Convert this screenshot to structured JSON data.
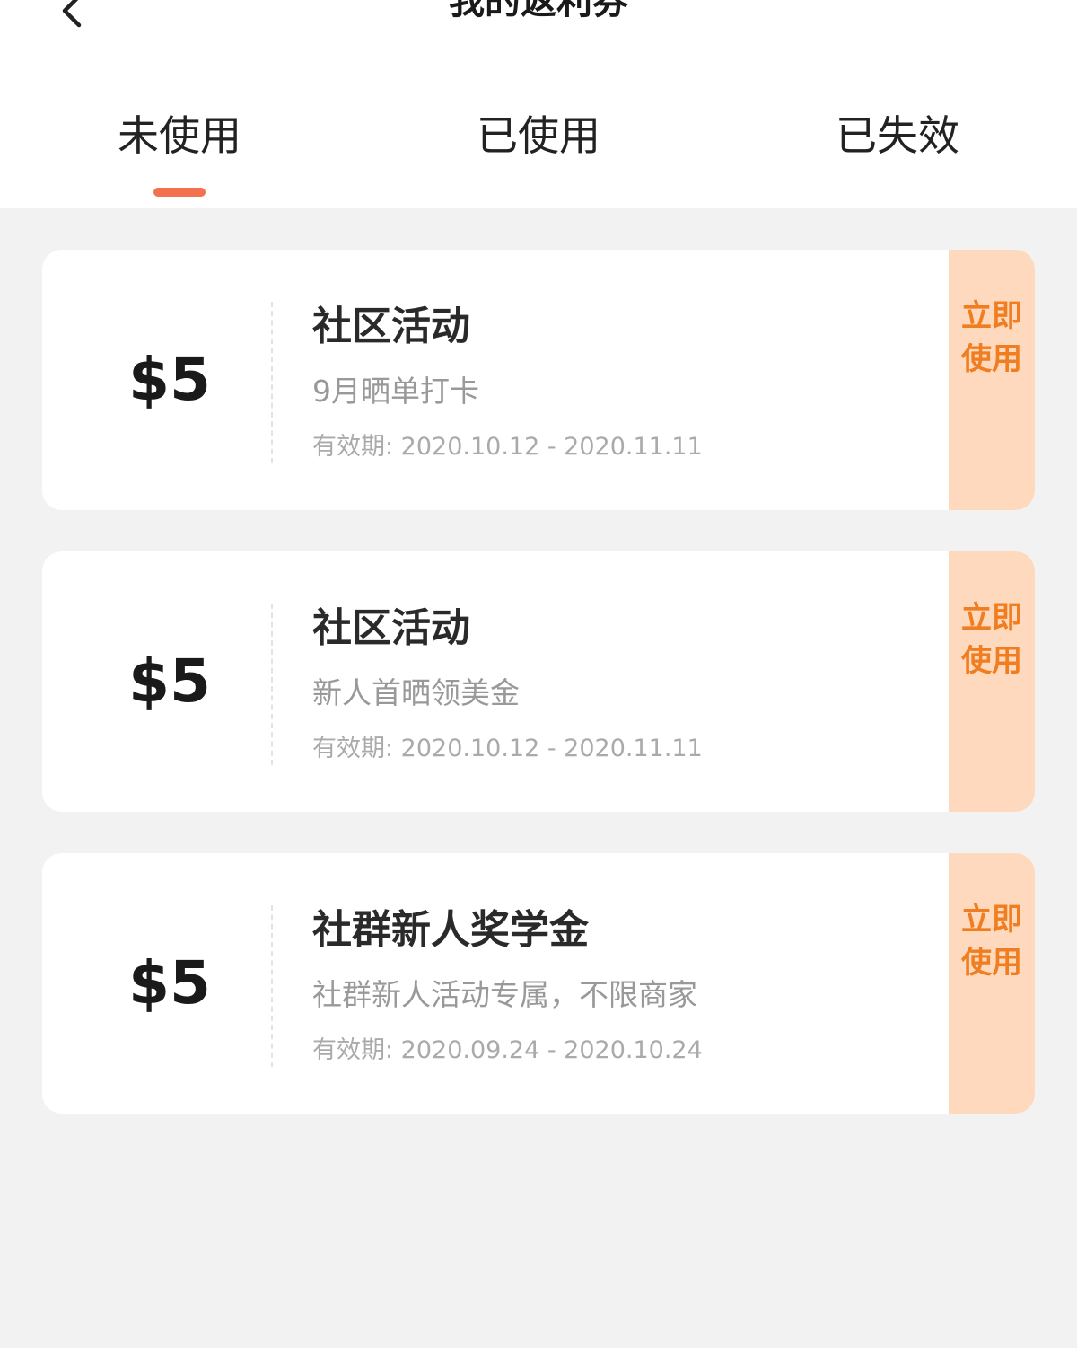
{
  "header": {
    "title": "我的返利券",
    "back_icon": "chevron-left-icon"
  },
  "tabs": [
    {
      "label": "未使用",
      "active": true
    },
    {
      "label": "已使用",
      "active": false
    },
    {
      "label": "已失效",
      "active": false
    }
  ],
  "colors": {
    "accent": "#f4714f",
    "button_bg": "#ffd9bd",
    "button_text": "#f07d1f",
    "page_bg": "#f2f2f2"
  },
  "coupons": [
    {
      "amount": "$5",
      "title": "社区活动",
      "subtitle": "9月晒单打卡",
      "validity": "有效期: 2020.10.12 - 2020.11.11",
      "button_label": "立即使用"
    },
    {
      "amount": "$5",
      "title": "社区活动",
      "subtitle": "新人首晒领美金",
      "validity": "有效期: 2020.10.12 - 2020.11.11",
      "button_label": "立即使用"
    },
    {
      "amount": "$5",
      "title": "社群新人奖学金",
      "subtitle": "社群新人活动专属，不限商家",
      "validity": "有效期: 2020.09.24 - 2020.10.24",
      "button_label": "立即使用"
    }
  ]
}
